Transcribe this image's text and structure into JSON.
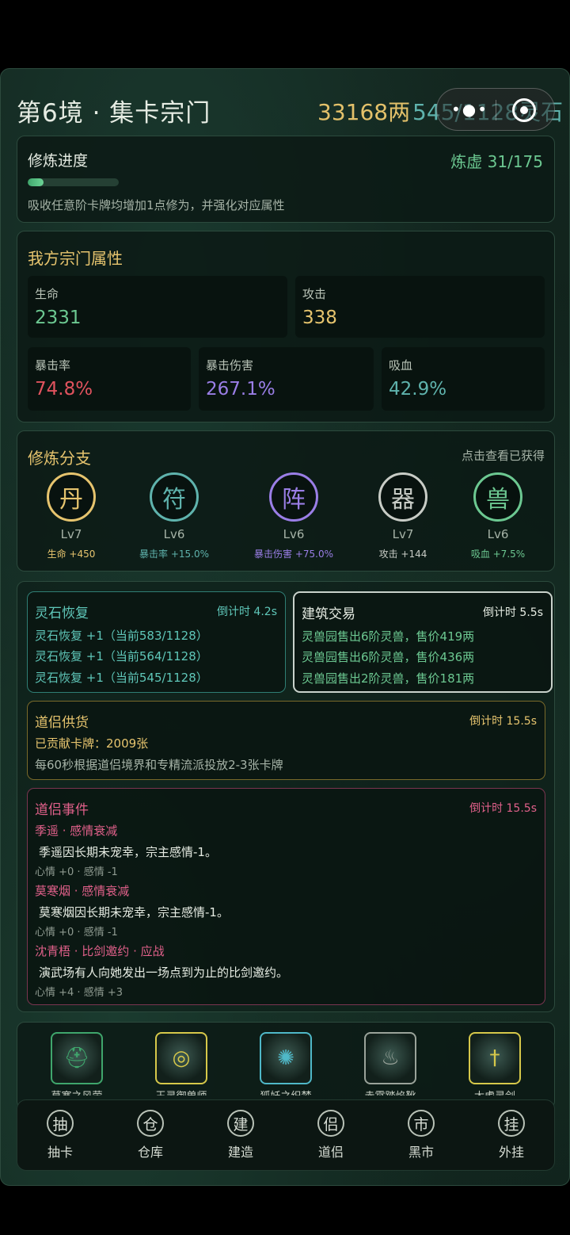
{
  "header": {
    "title": "第6境 · 集卡宗门",
    "gold": "33168两",
    "stones": "545/1128灵石"
  },
  "cultivation": {
    "label": "修炼进度",
    "realm": "炼虚 31/175",
    "progress": 0.177,
    "desc": "吸收任意阶卡牌均增加1点修为，并强化对应属性"
  },
  "attributes": {
    "title": "我方宗门属性",
    "stats": [
      {
        "label": "生命",
        "value": "2331",
        "color": "#6cc891"
      },
      {
        "label": "攻击",
        "value": "338",
        "color": "#e6c46e"
      },
      {
        "label": "暴击率",
        "value": "74.8%",
        "color": "#e0535e"
      },
      {
        "label": "暴击伤害",
        "value": "267.1%",
        "color": "#9a7ee6"
      },
      {
        "label": "吸血",
        "value": "42.9%",
        "color": "#5fb3ad"
      }
    ]
  },
  "branches": {
    "title": "修炼分支",
    "hint": "点击查看已获得",
    "items": [
      {
        "glyph": "丹",
        "lv": "Lv7",
        "bonus": "生命 +450",
        "color": "#e6c46e"
      },
      {
        "glyph": "符",
        "lv": "Lv6",
        "bonus": "暴击率 +15.0%",
        "color": "#5fb3ad"
      },
      {
        "glyph": "阵",
        "lv": "Lv6",
        "bonus": "暴击伤害 +75.0%",
        "color": "#9a7ee6"
      },
      {
        "glyph": "器",
        "lv": "Lv7",
        "bonus": "攻击 +144",
        "color": "#c8ccc6"
      },
      {
        "glyph": "兽",
        "lv": "Lv6",
        "bonus": "吸血 +7.5%",
        "color": "#6cc891"
      }
    ]
  },
  "events": {
    "stone_recovery": {
      "title": "灵石恢复",
      "timer": "倒计时 4.2s",
      "lines": [
        "灵石恢复 +1（当前583/1128）",
        "灵石恢复 +1（当前564/1128）",
        "灵石恢复 +1（当前545/1128）"
      ]
    },
    "building_trade": {
      "title": "建筑交易",
      "timer": "倒计时 5.5s",
      "lines": [
        "灵兽园售出6阶灵兽，售价419两",
        "灵兽园售出6阶灵兽，售价436两",
        "灵兽园售出2阶灵兽，售价181两"
      ]
    },
    "supply": {
      "title": "道侣供货",
      "timer": "倒计时 15.5s",
      "contributed": "已贡献卡牌：2009张",
      "desc": "每60秒根据道侣境界和专精流派投放2-3张卡牌"
    },
    "partner_events": {
      "title": "道侣事件",
      "timer": "倒计时 15.5s",
      "items": [
        {
          "head": "季遥 · 感情衰减",
          "body": "季遥因长期未宠幸，宗主感情-1。",
          "stats": "心情 +0 · 感情 -1"
        },
        {
          "head": "莫寒烟 · 感情衰减",
          "body": "莫寒烟因长期未宠幸，宗主感情-1。",
          "stats": "心情 +0 · 感情 -1"
        },
        {
          "head": "沈青梧 · 比剑邀约 · 应战",
          "body": "演武场有人向她发出一场点到为止的比剑邀约。",
          "stats": "心情 +4 · 感情 +3"
        }
      ]
    }
  },
  "partners": [
    {
      "name": "莫塞之风萤",
      "icon": "helmet-icon",
      "border": "#3fa66c"
    },
    {
      "name": "玉灵御兽师",
      "icon": "ring-icon",
      "border": "#d6c84a"
    },
    {
      "name": "狐妖之织梦",
      "icon": "spider-icon",
      "border": "#4fb8c8"
    },
    {
      "name": "赤霄踏焰靴",
      "icon": "boots-icon",
      "border": "#9aa39a"
    },
    {
      "name": "太虚灵剑",
      "icon": "sword-icon",
      "border": "#d6c84a"
    }
  ],
  "nav": [
    {
      "glyph": "抽",
      "label": "抽卡"
    },
    {
      "glyph": "仓",
      "label": "仓库"
    },
    {
      "glyph": "建",
      "label": "建造"
    },
    {
      "glyph": "侣",
      "label": "道侣"
    },
    {
      "glyph": "市",
      "label": "黑市"
    },
    {
      "glyph": "挂",
      "label": "外挂"
    }
  ]
}
